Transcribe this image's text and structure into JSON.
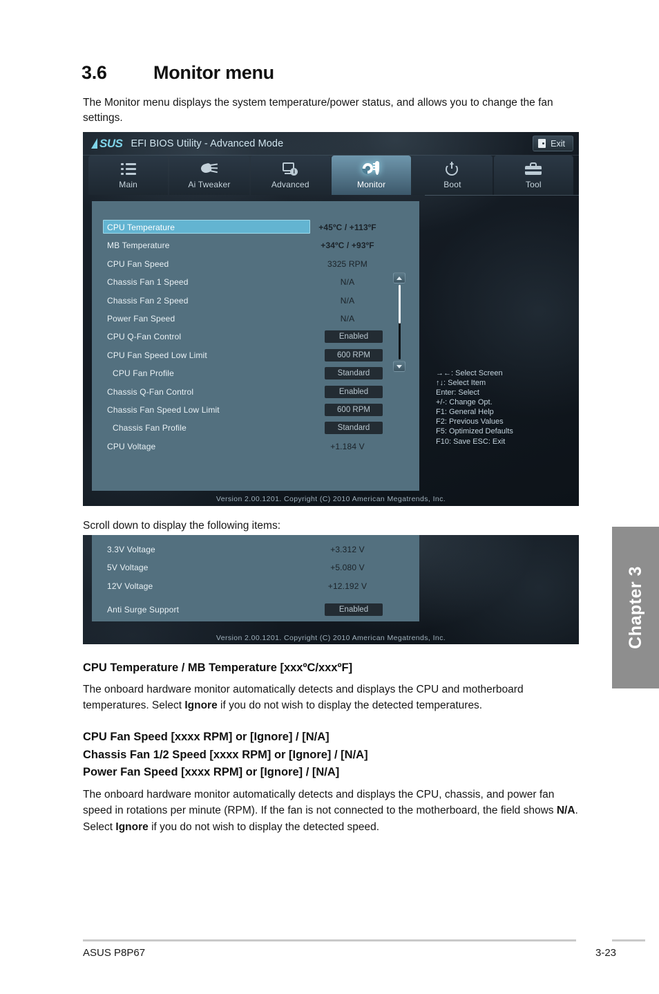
{
  "document": {
    "section_number": "3.6",
    "section_title": "Monitor menu",
    "intro": "The Monitor menu displays the system temperature/power status, and allows you to change the fan settings.",
    "scroll_note": "Scroll down to display the following items:",
    "heading_1": "CPU Temperature / MB Temperature [xxxºC/xxxºF]",
    "para_1_a": "The onboard hardware monitor automatically detects and displays the CPU and motherboard temperatures. Select ",
    "para_1_b": "Ignore",
    "para_1_c": " if you do not wish to display the detected temperatures.",
    "heading_2_line1": "CPU Fan Speed [xxxx RPM] or [Ignore] / [N/A]",
    "heading_2_line2": "Chassis Fan 1/2 Speed [xxxx RPM] or [Ignore] / [N/A]",
    "heading_2_line3": "Power Fan Speed [xxxx RPM] or [Ignore] / [N/A]",
    "para_2_a": "The onboard hardware monitor automatically detects and displays the CPU, chassis, and power fan speed in rotations per minute (RPM). If the fan is not connected to the motherboard, the field shows ",
    "para_2_b": "N/A",
    "para_2_c": ". Select ",
    "para_2_d": "Ignore",
    "para_2_e": " if you do not wish to display the detected speed.",
    "chapter_tab": "Chapter 3",
    "footer_left": "ASUS P8P67",
    "footer_right": "3-23"
  },
  "bios": {
    "title": "EFI BIOS Utility - Advanced Mode",
    "logo_text": "SUS",
    "exit_label": "Exit",
    "exit_icon": "exit-door-icon",
    "tabs": [
      {
        "label": "Main",
        "icon": "list-icon",
        "active": false
      },
      {
        "label": "Ai  Tweaker",
        "icon": "tweaker-icon",
        "active": false
      },
      {
        "label": "Advanced",
        "icon": "monitor-info-icon",
        "active": false
      },
      {
        "label": "Monitor",
        "icon": "fan-thermometer-icon",
        "active": true
      },
      {
        "label": "Boot",
        "icon": "power-icon",
        "active": false
      },
      {
        "label": "Tool",
        "icon": "toolbox-icon",
        "active": false
      }
    ],
    "items": [
      {
        "label": "CPU Temperature",
        "value": "+45ºC / +113ºF",
        "type": "value",
        "selected": true,
        "bold": true,
        "indent": false
      },
      {
        "label": "MB Temperature",
        "value": "+34ºC / +93ºF",
        "type": "value",
        "selected": false,
        "bold": true,
        "indent": false
      },
      {
        "label": "CPU Fan Speed",
        "value": "3325 RPM",
        "type": "value",
        "selected": false,
        "bold": false,
        "indent": false
      },
      {
        "label": "Chassis Fan 1 Speed",
        "value": "N/A",
        "type": "value",
        "selected": false,
        "bold": false,
        "indent": false
      },
      {
        "label": "Chassis Fan 2 Speed",
        "value": "N/A",
        "type": "value",
        "selected": false,
        "bold": false,
        "indent": false
      },
      {
        "label": "Power Fan Speed",
        "value": "N/A",
        "type": "value",
        "selected": false,
        "bold": false,
        "indent": false
      },
      {
        "label": "CPU Q-Fan Control",
        "value": "Enabled",
        "type": "option",
        "selected": false,
        "bold": false,
        "indent": false
      },
      {
        "label": "CPU Fan Speed Low Limit",
        "value": "600 RPM",
        "type": "option",
        "selected": false,
        "bold": false,
        "indent": false
      },
      {
        "label": "CPU Fan Profile",
        "value": "Standard",
        "type": "option",
        "selected": false,
        "bold": false,
        "indent": true
      },
      {
        "label": "Chassis Q-Fan Control",
        "value": "Enabled",
        "type": "option",
        "selected": false,
        "bold": false,
        "indent": false
      },
      {
        "label": "Chassis Fan Speed Low Limit",
        "value": "600 RPM",
        "type": "option",
        "selected": false,
        "bold": false,
        "indent": false
      },
      {
        "label": "Chassis Fan Profile",
        "value": "Standard",
        "type": "option",
        "selected": false,
        "bold": false,
        "indent": true
      },
      {
        "label": "CPU Voltage",
        "value": "+1.184 V",
        "type": "value",
        "selected": false,
        "bold": false,
        "indent": false
      }
    ],
    "help_keys": [
      "→←:  Select Screen",
      "↑↓:  Select Item",
      "Enter:  Select",
      "+/-:  Change Opt.",
      "F1:  General Help",
      "F2:  Previous Values",
      "F5:  Optimized Defaults",
      "F10:  Save    ESC:  Exit"
    ],
    "version": "Version  2.00.1201.   Copyright  (C)  2010  American  Megatrends,  Inc."
  },
  "bios_scrolled": {
    "items": [
      {
        "label": "3.3V Voltage",
        "value": "+3.312 V",
        "type": "value"
      },
      {
        "label": "5V Voltage",
        "value": "+5.080 V",
        "type": "value"
      },
      {
        "label": "12V Voltage",
        "value": "+12.192 V",
        "type": "value"
      },
      {
        "label": "Anti Surge Support",
        "value": "Enabled",
        "type": "option"
      }
    ],
    "version": "Version  2.00.1201.   Copyright  (C)  2010  American  Megatrends,  Inc."
  },
  "colors": {
    "panel_blue": "#53707f",
    "highlight": "#63b4d1",
    "accent_cyan": "#7fd3e8",
    "chapter_tab_gray": "#8e8e8e"
  }
}
